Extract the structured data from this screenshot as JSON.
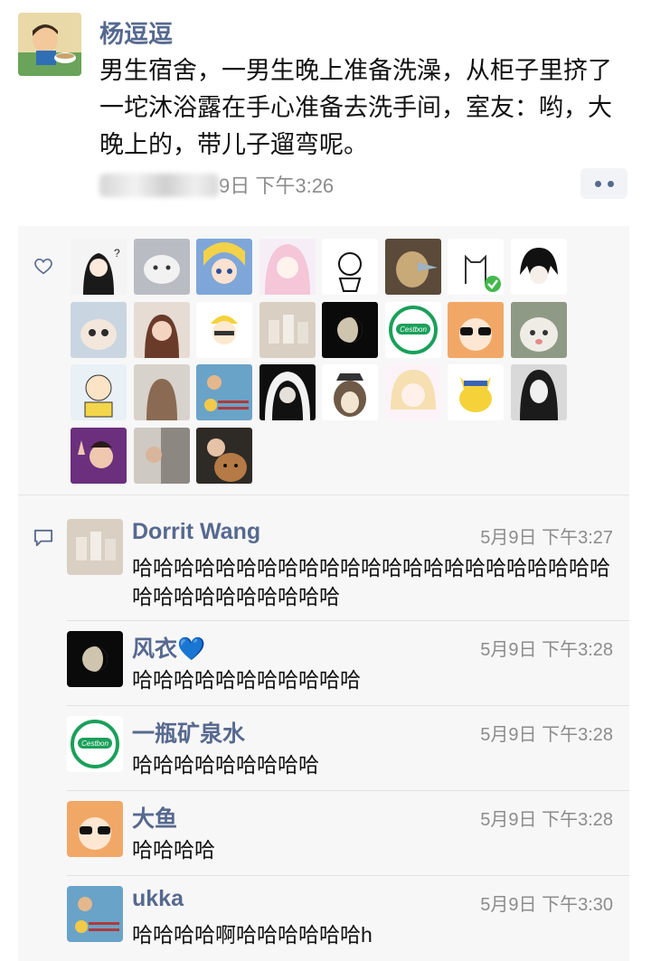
{
  "post": {
    "author": "杨逗逗",
    "text": "男生宿舍，一男生晚上准备洗澡，从柜子里挤了一坨沐浴露在手心准备去洗手间，室友：哟，大晚上的，带儿子遛弯呢。",
    "time_visible": "9日 下午3:26"
  },
  "likes": {
    "icon": "heart-outline-icon",
    "avatars": [
      "avatar-girl-question",
      "avatar-white-cat-toy",
      "avatar-sailor-moon",
      "avatar-anime-pink-hair",
      "avatar-bear-doodle",
      "avatar-bird",
      "avatar-cat-doodle-verified",
      "avatar-anime-fox-boy",
      "avatar-kitten",
      "avatar-girl-eating",
      "avatar-cartoon-baby-hat",
      "avatar-glass-cups",
      "avatar-moon",
      "avatar-cestbon-logo",
      "avatar-umaru-sunglasses",
      "avatar-cat-photo",
      "avatar-charlie-brown",
      "avatar-girl-back",
      "avatar-mouse-pattern",
      "avatar-woman-portrait",
      "avatar-penguin-hat",
      "avatar-anime-girl-blonde",
      "avatar-pikachu",
      "avatar-long-hair-sketch",
      "avatar-guy-peace-sign",
      "avatar-door-man",
      "avatar-man-with-dog"
    ]
  },
  "comments": [
    {
      "name": "Dorrit Wang",
      "time": "5月9日 下午3:27",
      "text": "哈哈哈哈哈哈哈哈哈哈哈哈哈哈哈哈哈哈哈哈哈哈哈哈哈哈哈哈哈哈哈哈哈",
      "avatar": "avatar-glass-cups"
    },
    {
      "name": "风衣",
      "emoji": "💙",
      "time": "5月9日 下午3:28",
      "text": "哈哈哈哈哈哈哈哈哈哈哈",
      "avatar": "avatar-moon"
    },
    {
      "name": "一瓶矿泉水",
      "time": "5月9日 下午3:28",
      "text": "哈哈哈哈哈哈哈哈哈",
      "avatar": "avatar-cestbon-logo"
    },
    {
      "name": "大鱼",
      "time": "5月9日 下午3:28",
      "text": "哈哈哈哈",
      "avatar": "avatar-umaru-sunglasses"
    },
    {
      "name": "ukka",
      "time": "5月9日 下午3:30",
      "text": "哈哈哈哈啊哈哈哈哈哈哈h",
      "avatar": "avatar-mouse-pattern"
    }
  ],
  "brand": {
    "cestbon": "Cestbon"
  },
  "colors": {
    "name_link": "#56698f",
    "timestamp": "#8c8c8c",
    "panel_bg": "#f7f7f7",
    "cestbon_green": "#1aa05a"
  }
}
